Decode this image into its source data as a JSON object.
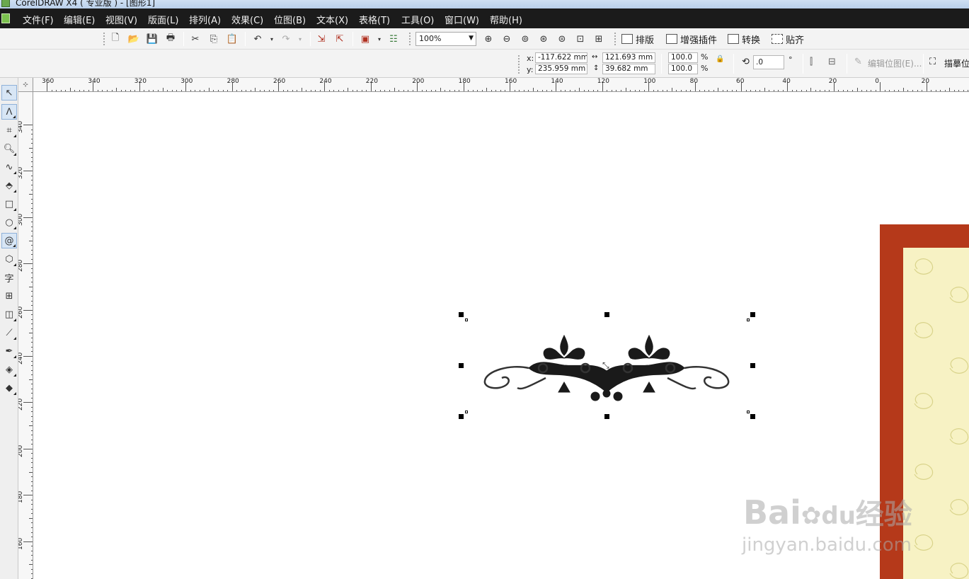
{
  "window": {
    "title": "CorelDRAW X4 ( 专业版 ) - [图形1]"
  },
  "menu": {
    "items": [
      "文件(F)",
      "编辑(E)",
      "视图(V)",
      "版面(L)",
      "排列(A)",
      "效果(C)",
      "位图(B)",
      "文本(X)",
      "表格(T)",
      "工具(O)",
      "窗口(W)",
      "帮助(H)"
    ]
  },
  "toolbar": {
    "zoom_value": "100%",
    "layout_label": "排版",
    "plugins_label": "增强插件",
    "convert_label": "转换",
    "snap_label": "贴齐"
  },
  "property_bar": {
    "x_label": "x:",
    "x_value": "-117.622 mm",
    "y_label": "y:",
    "y_value": "235.959 mm",
    "width_value": "121.693 mm",
    "height_value": "39.682 mm",
    "scale_x": "100.0",
    "scale_y": "100.0",
    "percent_symbol": "%",
    "rotation_value": ".0",
    "degree_symbol": "°",
    "edit_bitmap_label": "编辑位图(E)...",
    "trace_bitmap_label": "描摹位"
  },
  "rulers": {
    "top_labels": [
      "360",
      "340",
      "320",
      "300",
      "280",
      "260",
      "240",
      "220",
      "200",
      "180",
      "160",
      "140",
      "120",
      "100",
      "80",
      "60",
      "40",
      "20",
      "0",
      "20"
    ],
    "left_labels": [
      "340",
      "320",
      "300",
      "280",
      "260",
      "240",
      "220",
      "200",
      "180",
      "160"
    ]
  },
  "tools": {
    "text_tool_glyph": "字"
  },
  "watermark": {
    "brand": "Bai",
    "brand_du": "du",
    "brand_cn": "经验",
    "url": "jingyan.baidu.com"
  },
  "colors": {
    "menubar_bg": "#1b1b1b",
    "card_border": "#b5391a",
    "card_fill": "#f7f2c4",
    "selection_handle": "#000000"
  }
}
